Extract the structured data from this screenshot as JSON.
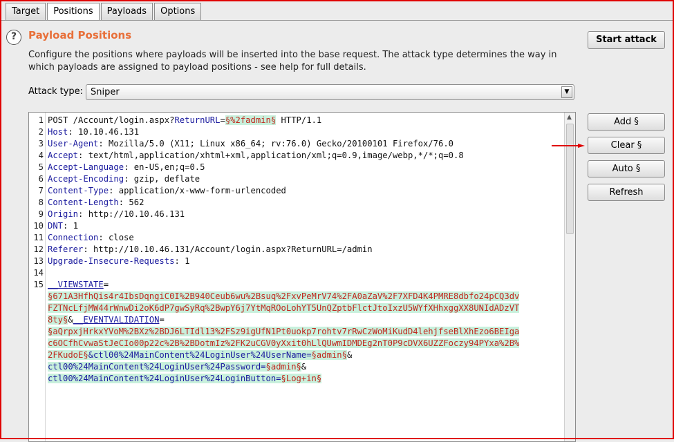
{
  "tabs": [
    "Target",
    "Positions",
    "Payloads",
    "Options"
  ],
  "active_tab": "Positions",
  "panel": {
    "title": "Payload Positions",
    "description": "Configure the positions where payloads will be inserted into the base request. The attack type determines the way in which payloads are assigned to payload positions - see help for full details.",
    "start_attack_label": "Start attack"
  },
  "attack_type": {
    "label": "Attack type:",
    "value": "Sniper"
  },
  "buttons": {
    "add": "Add §",
    "clear": "Clear §",
    "auto": "Auto §",
    "refresh": "Refresh"
  },
  "colors": {
    "title": "#e8703a",
    "marker_bg": "#c8f0dc",
    "marker_text": "#c0281e",
    "annotation_arrow": "#e00000"
  },
  "request_lines": [
    {
      "num": "1",
      "segs": [
        {
          "t": "POST /Account/login.aspx?"
        },
        {
          "t": "ReturnURL",
          "c": "hk"
        },
        {
          "t": "="
        },
        {
          "t": "§%2fadmin§",
          "c": "pm"
        },
        {
          "t": " HTTP/1.1"
        }
      ]
    },
    {
      "num": "2",
      "segs": [
        {
          "t": "Host",
          "c": "hk"
        },
        {
          "t": ": 10.10.46.131"
        }
      ]
    },
    {
      "num": "3",
      "segs": [
        {
          "t": "User-Agent",
          "c": "hk"
        },
        {
          "t": ": Mozilla/5.0 (X11; Linux x86_64; rv:76.0) Gecko/20100101 Firefox/76.0"
        }
      ]
    },
    {
      "num": "4",
      "segs": [
        {
          "t": "Accept",
          "c": "hk"
        },
        {
          "t": ": text/html,application/xhtml+xml,application/xml;q=0.9,image/webp,*/*;q=0.8"
        }
      ]
    },
    {
      "num": "5",
      "segs": [
        {
          "t": "Accept-Language",
          "c": "hk"
        },
        {
          "t": ": en-US,en;q=0.5"
        }
      ]
    },
    {
      "num": "6",
      "segs": [
        {
          "t": "Accept-Encoding",
          "c": "hk"
        },
        {
          "t": ": gzip, deflate"
        }
      ]
    },
    {
      "num": "7",
      "segs": [
        {
          "t": "Content-Type",
          "c": "hk"
        },
        {
          "t": ": application/x-www-form-urlencoded"
        }
      ]
    },
    {
      "num": "8",
      "segs": [
        {
          "t": "Content-Length",
          "c": "hk"
        },
        {
          "t": ": 562"
        }
      ]
    },
    {
      "num": "9",
      "segs": [
        {
          "t": "Origin",
          "c": "hk"
        },
        {
          "t": ": http://10.10.46.131"
        }
      ]
    },
    {
      "num": "10",
      "segs": [
        {
          "t": "DNT",
          "c": "hk"
        },
        {
          "t": ": 1"
        }
      ]
    },
    {
      "num": "11",
      "segs": [
        {
          "t": "Connection",
          "c": "hk"
        },
        {
          "t": ": close"
        }
      ]
    },
    {
      "num": "12",
      "segs": [
        {
          "t": "Referer",
          "c": "hk"
        },
        {
          "t": ": http://10.10.46.131/Account/login.aspx?ReturnURL=/admin"
        }
      ]
    },
    {
      "num": "13",
      "segs": [
        {
          "t": "Upgrade-Insecure-Requests",
          "c": "hk"
        },
        {
          "t": ": 1"
        }
      ]
    },
    {
      "num": "14",
      "segs": []
    },
    {
      "num": "15",
      "segs": [
        {
          "t": "__VIEWSTATE",
          "c": "vs"
        },
        {
          "t": "="
        }
      ]
    },
    {
      "num": "",
      "segs": [
        {
          "t": "§671A3HfhQis4r4IbsDqngiC0I%2B940Ceub6wu%2Bsuq%2FxvPeMrV74%2FA0aZaV%2F7XFD4K4PMRE8dbfo24pCQ3dv",
          "c": "pm"
        }
      ]
    },
    {
      "num": "",
      "segs": [
        {
          "t": "FZTNcLfjMW44rWnwDi2oK6dP7gwSyRq%2BwpY6j7YtMqROoLohYT5UnQZptbFlctJtoIxzU5WYfXHhxggXX8UNIdADzVT",
          "c": "pm"
        }
      ]
    },
    {
      "num": "",
      "segs": [
        {
          "t": "8ty§",
          "c": "pm"
        },
        {
          "t": "&"
        },
        {
          "t": "__EVENTVALIDATION",
          "c": "vs"
        },
        {
          "t": "="
        }
      ]
    },
    {
      "num": "",
      "segs": [
        {
          "t": "§aQrpxjHrkxYVoM%2BXz%2BDJ6LTIdl13%2FSz9igUfN1Pt0uokp7rohtv7rRwCzWoMiKudD4lehjfseBlXhEzo6BEIga",
          "c": "pm"
        }
      ]
    },
    {
      "num": "",
      "segs": [
        {
          "t": "c6OCfhCvwaStJeCIo00p22c%2B%2BDotmIz%2FK2uCGV0yXxit0hLlQUwmIDMDEg2nT0P9cDVX6UZZFoczy94PYxa%2B%",
          "c": "pm"
        }
      ]
    },
    {
      "num": "",
      "segs": [
        {
          "t": "2FKudoE§",
          "c": "pm"
        },
        {
          "t": "&ctl00%24MainContent%24LoginUser%24UserName=",
          "c": "pk"
        },
        {
          "t": "§admin§",
          "c": "pm"
        },
        {
          "t": "&"
        }
      ]
    },
    {
      "num": "",
      "segs": [
        {
          "t": "ctl00%24MainContent%24LoginUser%24Password=",
          "c": "pk"
        },
        {
          "t": "§admin§",
          "c": "pm"
        },
        {
          "t": "&"
        }
      ]
    },
    {
      "num": "",
      "segs": [
        {
          "t": "ctl00%24MainContent%24LoginUser%24LoginButton=",
          "c": "pk"
        },
        {
          "t": "§Log+in§",
          "c": "pm"
        }
      ]
    }
  ]
}
